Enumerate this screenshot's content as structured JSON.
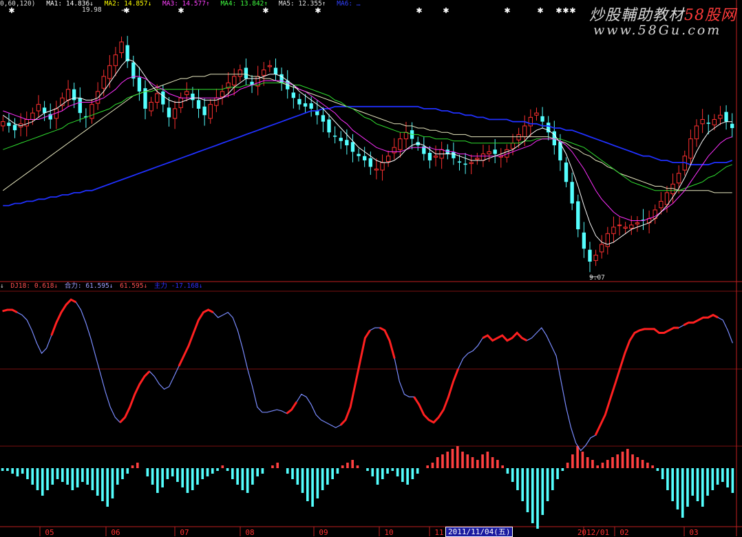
{
  "header": {
    "params": "0,60,120)",
    "ma1": {
      "label": "MA1:",
      "value": "14.836↓",
      "color": "#ffffff"
    },
    "ma2": {
      "label": "MA2:",
      "value": "14.857↓",
      "color": "#ffff00"
    },
    "ma3": {
      "label": "MA3:",
      "value": "14.577↑",
      "color": "#ff00ff"
    },
    "ma4": {
      "label": "MA4:",
      "value": "13.842↑",
      "color": "#00ff00"
    },
    "ma5": {
      "label": "MA5:",
      "value": "12.355↑",
      "color": "#e0e0e0"
    },
    "ma6": {
      "label": "MA6:",
      "value": "…",
      "color": "#3040ff"
    }
  },
  "indicator_header": {
    "prefix": "↓",
    "dj18": {
      "label": "DJ18:",
      "value": "0.618↓",
      "color": "#ff4040"
    },
    "heli": {
      "label": "合力:",
      "value": "61.595↓",
      "color": "#a0a0ff"
    },
    "v3": {
      "value": "61.595↓",
      "color": "#ff4040"
    },
    "v4": {
      "label": "主力",
      "value": "-17.168↓",
      "color": "#3030ff"
    }
  },
  "watermark": {
    "line1_a": "炒股輔助教材",
    "line1_b": "58股网",
    "line2": "www.58Gu.com"
  },
  "price_labels": {
    "high": "19.98",
    "low": "9.07"
  },
  "x_axis_labels": [
    "05",
    "06",
    "07",
    "08",
    "09",
    "10",
    "11",
    "2012/01",
    "02",
    "03"
  ],
  "selected_date": "2011/11/04(五)",
  "chart_data": {
    "type": "candlestick",
    "price": {
      "ylim": [
        8.5,
        21.0
      ],
      "high_label": 19.98,
      "low_label": 9.07,
      "close": [
        15.8,
        15.6,
        15.4,
        15.7,
        15.9,
        16.2,
        16.6,
        16.2,
        15.9,
        16.4,
        16.9,
        17.3,
        16.8,
        16.2,
        16.0,
        16.6,
        17.2,
        17.9,
        18.4,
        18.9,
        19.5,
        18.6,
        17.8,
        17.2,
        16.4,
        16.7,
        17.1,
        16.6,
        16.0,
        16.4,
        16.9,
        17.2,
        16.8,
        16.4,
        16.1,
        16.6,
        16.9,
        17.2,
        17.6,
        17.9,
        18.2,
        17.8,
        17.5,
        17.9,
        18.2,
        18.4,
        18.0,
        17.6,
        17.3,
        16.9,
        16.6,
        16.5,
        16.4,
        16.1,
        15.8,
        15.3,
        15.1,
        14.9,
        14.7,
        14.4,
        14.2,
        14.0,
        13.7,
        13.6,
        13.9,
        14.2,
        14.6,
        15.0,
        15.3,
        15.0,
        14.7,
        14.3,
        14.0,
        14.2,
        14.5,
        14.3,
        14.1,
        13.9,
        13.8,
        13.9,
        14.1,
        14.3,
        14.4,
        14.3,
        14.2,
        14.5,
        14.8,
        15.2,
        15.6,
        16.0,
        16.2,
        15.8,
        15.3,
        14.7,
        14.0,
        13.0,
        12.0,
        10.8,
        9.9,
        9.3,
        9.6,
        10.1,
        10.6,
        10.9,
        11.0,
        10.9,
        11.0,
        11.1,
        11.2,
        11.3,
        11.7,
        12.1,
        12.5,
        12.9,
        13.4,
        14.2,
        15.0,
        15.6,
        15.9,
        15.7,
        15.9,
        16.1,
        15.8,
        15.5
      ],
      "ma_short": [
        16.1,
        15.9,
        15.7,
        15.6,
        15.7,
        15.8,
        16.0,
        16.2,
        16.3,
        16.4,
        16.6,
        16.8,
        16.9,
        16.9,
        16.8,
        16.8,
        16.9,
        17.2,
        17.6,
        18.0,
        18.4,
        18.7,
        18.6,
        18.3,
        17.9,
        17.5,
        17.2,
        17.0,
        16.8,
        16.7,
        16.7,
        16.8,
        16.9,
        16.9,
        16.8,
        16.8,
        16.8,
        16.9,
        17.1,
        17.4,
        17.6,
        17.8,
        17.8,
        17.8,
        17.9,
        18.0,
        18.0,
        17.9,
        17.7,
        17.5,
        17.2,
        17.0,
        16.8,
        16.6,
        16.4,
        16.1,
        15.8,
        15.5,
        15.2,
        14.9,
        14.6,
        14.4,
        14.2,
        14.0,
        13.9,
        13.9,
        14.0,
        14.2,
        14.5,
        14.7,
        14.8,
        14.7,
        14.5,
        14.3,
        14.3,
        14.3,
        14.3,
        14.2,
        14.1,
        14.0,
        14.0,
        14.0,
        14.1,
        14.2,
        14.3,
        14.4,
        14.5,
        14.7,
        14.9,
        15.2,
        15.4,
        15.5,
        15.4,
        15.2,
        14.8,
        14.3,
        13.6,
        12.8,
        11.9,
        11.1,
        10.5,
        10.2,
        10.1,
        10.2,
        10.4,
        10.6,
        10.8,
        10.9,
        11.0,
        11.1,
        11.3,
        11.6,
        11.9,
        12.3,
        12.7,
        13.2,
        13.8,
        14.4,
        14.9,
        15.3,
        15.5,
        15.7,
        15.8,
        15.8
      ],
      "ma_mid": [
        16.3,
        16.2,
        16.1,
        16.0,
        15.9,
        15.9,
        15.9,
        16.0,
        16.1,
        16.2,
        16.3,
        16.5,
        16.6,
        16.7,
        16.7,
        16.7,
        16.8,
        16.9,
        17.1,
        17.3,
        17.6,
        17.8,
        17.9,
        17.9,
        17.8,
        17.6,
        17.4,
        17.3,
        17.1,
        17.0,
        16.9,
        16.9,
        16.9,
        16.9,
        16.9,
        16.9,
        16.9,
        16.9,
        17.0,
        17.1,
        17.3,
        17.4,
        17.5,
        17.6,
        17.7,
        17.7,
        17.7,
        17.7,
        17.6,
        17.5,
        17.3,
        17.2,
        17.0,
        16.8,
        16.6,
        16.4,
        16.2,
        15.9,
        15.7,
        15.4,
        15.2,
        15.0,
        14.8,
        14.6,
        14.5,
        14.4,
        14.4,
        14.4,
        14.5,
        14.6,
        14.6,
        14.6,
        14.6,
        14.5,
        14.5,
        14.4,
        14.4,
        14.3,
        14.3,
        14.2,
        14.2,
        14.2,
        14.2,
        14.2,
        14.2,
        14.3,
        14.4,
        14.5,
        14.6,
        14.7,
        14.9,
        15.0,
        15.0,
        15.0,
        14.9,
        14.7,
        14.4,
        14.0,
        13.6,
        13.1,
        12.6,
        12.2,
        11.9,
        11.6,
        11.4,
        11.3,
        11.2,
        11.2,
        11.2,
        11.3,
        11.4,
        11.6,
        11.8,
        12.0,
        12.3,
        12.6,
        13.0,
        13.4,
        13.8,
        14.2,
        14.5,
        14.8,
        15.0,
        15.1
      ],
      "ma_long": [
        14.5,
        14.6,
        14.7,
        14.8,
        14.9,
        15.0,
        15.1,
        15.2,
        15.3,
        15.4,
        15.5,
        15.7,
        15.8,
        15.9,
        16.0,
        16.1,
        16.2,
        16.3,
        16.4,
        16.6,
        16.7,
        16.9,
        17.0,
        17.1,
        17.2,
        17.2,
        17.3,
        17.3,
        17.3,
        17.3,
        17.3,
        17.3,
        17.3,
        17.3,
        17.3,
        17.3,
        17.3,
        17.3,
        17.4,
        17.4,
        17.4,
        17.5,
        17.5,
        17.5,
        17.6,
        17.6,
        17.6,
        17.6,
        17.6,
        17.5,
        17.5,
        17.4,
        17.3,
        17.2,
        17.1,
        17.0,
        16.8,
        16.7,
        16.5,
        16.4,
        16.2,
        16.0,
        15.9,
        15.7,
        15.6,
        15.5,
        15.4,
        15.3,
        15.3,
        15.2,
        15.2,
        15.1,
        15.1,
        15.0,
        15.0,
        15.0,
        14.9,
        14.9,
        14.9,
        14.8,
        14.8,
        14.8,
        14.8,
        14.8,
        14.8,
        14.8,
        14.8,
        14.8,
        14.9,
        14.9,
        15.0,
        15.0,
        15.0,
        15.0,
        15.0,
        14.9,
        14.8,
        14.7,
        14.6,
        14.4,
        14.2,
        14.0,
        13.8,
        13.6,
        13.4,
        13.2,
        13.0,
        12.9,
        12.8,
        12.7,
        12.6,
        12.6,
        12.6,
        12.6,
        12.6,
        12.7,
        12.8,
        12.9,
        13.0,
        13.2,
        13.3,
        13.5,
        13.7,
        13.8
      ],
      "ma_slow_white": [
        12.6,
        12.8,
        13.0,
        13.2,
        13.4,
        13.6,
        13.8,
        14.0,
        14.2,
        14.4,
        14.6,
        14.8,
        15.0,
        15.2,
        15.4,
        15.6,
        15.8,
        16.0,
        16.2,
        16.4,
        16.6,
        16.8,
        17.0,
        17.1,
        17.2,
        17.3,
        17.4,
        17.5,
        17.6,
        17.7,
        17.8,
        17.8,
        17.9,
        17.9,
        17.9,
        18.0,
        18.0,
        18.0,
        18.0,
        18.0,
        18.0,
        18.0,
        17.9,
        17.9,
        17.8,
        17.8,
        17.7,
        17.6,
        17.5,
        17.4,
        17.3,
        17.2,
        17.1,
        17.0,
        16.9,
        16.8,
        16.7,
        16.6,
        16.5,
        16.4,
        16.3,
        16.2,
        16.1,
        16.0,
        15.9,
        15.8,
        15.7,
        15.7,
        15.6,
        15.6,
        15.5,
        15.5,
        15.4,
        15.4,
        15.3,
        15.3,
        15.2,
        15.2,
        15.2,
        15.1,
        15.1,
        15.1,
        15.1,
        15.1,
        15.1,
        15.1,
        15.1,
        15.1,
        15.1,
        15.1,
        15.1,
        15.1,
        15.1,
        15.0,
        14.9,
        14.8,
        14.6,
        14.5,
        14.3,
        14.2,
        14.0,
        13.9,
        13.7,
        13.6,
        13.4,
        13.3,
        13.2,
        13.1,
        13.0,
        12.9,
        12.8,
        12.8,
        12.7,
        12.7,
        12.6,
        12.6,
        12.6,
        12.6,
        12.6,
        12.6,
        12.5,
        12.5,
        12.5,
        12.5
      ],
      "ma_blue": [
        11.9,
        11.9,
        12.0,
        12.0,
        12.1,
        12.1,
        12.2,
        12.2,
        12.3,
        12.3,
        12.4,
        12.4,
        12.5,
        12.5,
        12.6,
        12.6,
        12.7,
        12.8,
        12.9,
        13.0,
        13.1,
        13.2,
        13.3,
        13.4,
        13.5,
        13.6,
        13.7,
        13.8,
        13.9,
        14.0,
        14.1,
        14.2,
        14.3,
        14.4,
        14.5,
        14.6,
        14.7,
        14.8,
        14.9,
        15.0,
        15.1,
        15.2,
        15.3,
        15.4,
        15.5,
        15.6,
        15.7,
        15.8,
        15.9,
        16.0,
        16.1,
        16.2,
        16.3,
        16.3,
        16.4,
        16.4,
        16.5,
        16.5,
        16.5,
        16.5,
        16.5,
        16.5,
        16.5,
        16.5,
        16.5,
        16.5,
        16.5,
        16.5,
        16.5,
        16.5,
        16.5,
        16.4,
        16.4,
        16.4,
        16.3,
        16.3,
        16.2,
        16.2,
        16.1,
        16.1,
        16.0,
        16.0,
        15.9,
        15.9,
        15.9,
        15.9,
        15.8,
        15.8,
        15.8,
        15.7,
        15.7,
        15.6,
        15.6,
        15.5,
        15.5,
        15.4,
        15.4,
        15.3,
        15.2,
        15.1,
        15.0,
        14.9,
        14.8,
        14.7,
        14.6,
        14.5,
        14.4,
        14.3,
        14.2,
        14.2,
        14.1,
        14.0,
        14.0,
        13.9,
        13.9,
        13.9,
        13.8,
        13.8,
        13.8,
        13.8,
        13.9,
        13.9,
        13.9,
        14.0
      ]
    },
    "indicator": {
      "ylim": [
        -25,
        110
      ],
      "line": [
        95,
        96,
        96,
        94,
        92,
        88,
        80,
        70,
        62,
        66,
        76,
        86,
        94,
        100,
        104,
        102,
        96,
        86,
        74,
        60,
        46,
        32,
        20,
        12,
        8,
        12,
        20,
        30,
        38,
        44,
        48,
        44,
        38,
        34,
        36,
        44,
        52,
        60,
        68,
        78,
        88,
        94,
        96,
        94,
        90,
        92,
        94,
        90,
        80,
        66,
        50,
        36,
        20,
        16,
        16,
        17,
        18,
        17,
        15,
        18,
        24,
        30,
        28,
        22,
        14,
        10,
        8,
        6,
        4,
        6,
        10,
        20,
        38,
        56,
        74,
        80,
        82,
        82,
        80,
        72,
        58,
        40,
        30,
        28,
        28,
        22,
        14,
        10,
        8,
        12,
        18,
        28,
        40,
        50,
        58,
        62,
        64,
        68,
        74,
        76,
        72,
        74,
        76,
        72,
        74,
        78,
        74,
        72,
        74,
        78,
        82,
        76,
        68,
        60,
        40,
        20,
        4,
        -8,
        -14,
        -10,
        -4,
        -2,
        6,
        14,
        26,
        38,
        50,
        62,
        72,
        78,
        80,
        81,
        81,
        81,
        78,
        78,
        80,
        82,
        82,
        84,
        86,
        86,
        88,
        90,
        90,
        92,
        90,
        88,
        80,
        70
      ],
      "red_segments": [
        [
          0,
          3
        ],
        [
          10,
          15
        ],
        [
          24,
          30
        ],
        [
          36,
          43
        ],
        [
          58,
          60
        ],
        [
          69,
          75
        ],
        [
          77,
          80
        ],
        [
          84,
          93
        ],
        [
          98,
          107
        ],
        [
          121,
          138
        ],
        [
          139,
          146
        ]
      ],
      "histogram": [
        -1,
        -1,
        -2,
        -3,
        -2,
        -4,
        -6,
        -8,
        -10,
        -8,
        -6,
        -4,
        -5,
        -6,
        -8,
        -7,
        -5,
        -6,
        -8,
        -10,
        -12,
        -14,
        -11,
        -6,
        -4,
        -2,
        1,
        2,
        0,
        -3,
        -6,
        -9,
        -7,
        -4,
        -3,
        -5,
        -7,
        -9,
        -8,
        -6,
        -4,
        -3,
        -2,
        -1,
        1,
        -1,
        -4,
        -6,
        -8,
        -9,
        -6,
        -3,
        -2,
        0,
        1,
        2,
        0,
        -2,
        -4,
        -6,
        -9,
        -12,
        -14,
        -11,
        -8,
        -6,
        -4,
        -2,
        1,
        2,
        3,
        1,
        0,
        -1,
        -3,
        -6,
        -4,
        -2,
        -1,
        -3,
        -5,
        -6,
        -4,
        -2,
        0,
        1,
        2,
        4,
        5,
        6,
        7,
        8,
        6,
        5,
        4,
        3,
        5,
        6,
        4,
        3,
        1,
        -2,
        -5,
        -8,
        -12,
        -16,
        -20,
        -22,
        -17,
        -12,
        -8,
        -4,
        -1,
        2,
        5,
        8,
        6,
        4,
        3,
        1,
        2,
        3,
        4,
        5,
        6,
        7,
        5,
        4,
        3,
        2,
        1,
        -1,
        -4,
        -8,
        -12,
        -15,
        -18,
        -14,
        -10,
        -12,
        -14,
        -10,
        -8,
        -6,
        -5,
        -7,
        -9
      ],
      "hist_ylim": [
        -25,
        12
      ]
    },
    "x_labels": [
      "05",
      "06",
      "07",
      "08",
      "09",
      "10",
      "11",
      "2012/01",
      "02",
      "03"
    ]
  }
}
